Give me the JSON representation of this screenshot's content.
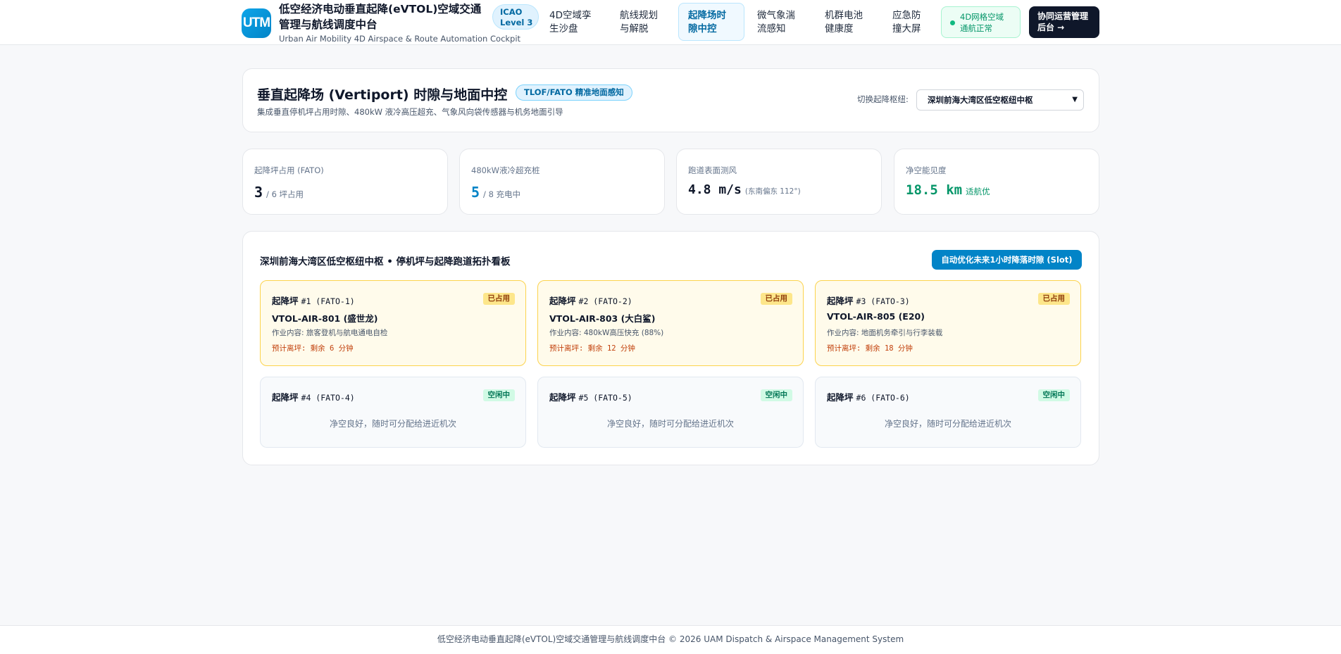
{
  "header": {
    "logo_text": "UTM",
    "title": "低空经济电动垂直起降(eVTOL)空域交通管理与航线调度中台",
    "subtitle": "Urban Air Mobility 4D Airspace & Route Automation Cockpit",
    "icao_line1": "ICAO",
    "icao_line2": "Level 3",
    "nav": [
      {
        "l1": "4D空域孪",
        "l2": "生沙盘"
      },
      {
        "l1": "航线规划",
        "l2": "与解脱"
      },
      {
        "l1": "起降场时",
        "l2": "隙中控"
      },
      {
        "l1": "微气象湍",
        "l2": "流感知"
      },
      {
        "l1": "机群电池",
        "l2": "健康度"
      },
      {
        "l1": "应急防",
        "l2": "撞大屏"
      }
    ],
    "status_line1": "4D网格空域",
    "status_line2": "通航正常",
    "admin_line1": "协同运营管理",
    "admin_line2": "后台 →",
    "accent_color": "#0284c7"
  },
  "title_panel": {
    "title": "垂直起降场 (Vertiport) 时隙与地面中控",
    "badge": "TLOF/FATO 精准地面感知",
    "description": "集成垂直停机坪占用时隙、480kW 液冷高压超充、气象风向袋传感器与机务地面引导",
    "hub_label": "切换起降枢纽:",
    "hub_selected": "深圳前海大湾区低空枢纽中枢"
  },
  "stats": [
    {
      "label": "起降坪占用 (FATO)",
      "value": "3",
      "unit": "/ 6 坪占用",
      "color": "#0f172a"
    },
    {
      "label": "480kW液冷超充桩",
      "value": "5",
      "unit": "/ 8 充电中",
      "color": "#0284c7"
    },
    {
      "label": "跑道表面测风",
      "value": "4.8 m/s",
      "unit": "(东南偏东 112°)",
      "color": "#0f172a"
    },
    {
      "label": "净空能见度",
      "value": "18.5 km",
      "unit": "适航优",
      "color": "#059669"
    }
  ],
  "board": {
    "title": "深圳前海大湾区低空枢纽中枢 • 停机坪与起降跑道拓扑看板",
    "optimize_button": "自动优化未来1小时降落时隙 (Slot)",
    "pads": [
      {
        "name": "起降坪",
        "code": "#1 (FATO-1)",
        "status": "已占用",
        "craft": "VTOL-AIR-801 (盛世龙)",
        "task": "作业内容: 旅客登机与航电通电自检",
        "eta": "预计离坪: 剩余 6 分钟"
      },
      {
        "name": "起降坪",
        "code": "#2 (FATO-2)",
        "status": "已占用",
        "craft": "VTOL-AIR-803 (大白鲨)",
        "task": "作业内容: 480kW高压快充 (88%)",
        "eta": "预计离坪: 剩余 12 分钟"
      },
      {
        "name": "起降坪",
        "code": "#3 (FATO-3)",
        "status": "已占用",
        "craft": "VTOL-AIR-805 (E20)",
        "task": "作业内容: 地面机务牵引与行李装载",
        "eta": "预计离坪: 剩余 18 分钟"
      },
      {
        "name": "起降坪",
        "code": "#4 (FATO-4)",
        "status": "空闲中",
        "note": "净空良好，随时可分配给进近机次"
      },
      {
        "name": "起降坪",
        "code": "#5 (FATO-5)",
        "status": "空闲中",
        "note": "净空良好，随时可分配给进近机次"
      },
      {
        "name": "起降坪",
        "code": "#6 (FATO-6)",
        "status": "空闲中",
        "note": "净空良好，随时可分配给进近机次"
      }
    ]
  },
  "footer": "低空经济电动垂直起降(eVTOL)空域交通管理与航线调度中台 © 2026 UAM Dispatch & Airspace Management System"
}
